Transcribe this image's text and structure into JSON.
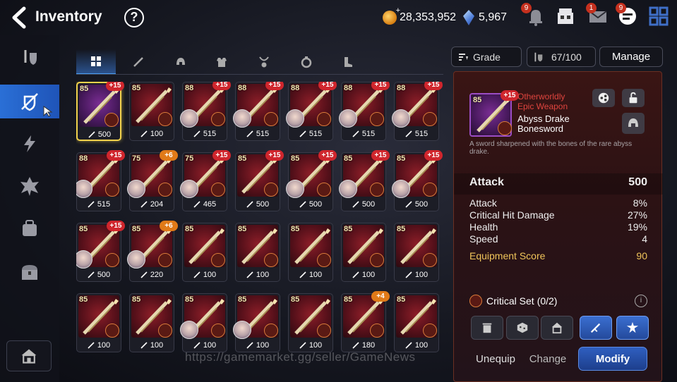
{
  "header": {
    "title": "Inventory",
    "help_label": "?",
    "gold": "28,353,952",
    "skystone": "5,967",
    "badges": {
      "alerts": "9",
      "mail": "1",
      "chat": "9"
    }
  },
  "sidebar": {
    "items": [
      "shield-icon",
      "gear-crossed-icon",
      "lightning-icon",
      "artifact-icon",
      "bag-icon",
      "chest-icon"
    ],
    "active_index": 1
  },
  "tabs": [
    "all",
    "weapon",
    "helmet",
    "armor",
    "necklace",
    "ring",
    "boots"
  ],
  "filter": {
    "sort_label": "Grade",
    "capacity": "67/100",
    "manage_label": "Manage"
  },
  "items": [
    {
      "lvl": "85",
      "enh": "+15",
      "score": "500",
      "hero": false,
      "purple": true,
      "selected": true
    },
    {
      "lvl": "85",
      "enh": "",
      "score": "100",
      "hero": false
    },
    {
      "lvl": "88",
      "enh": "+15",
      "score": "515",
      "hero": true
    },
    {
      "lvl": "88",
      "enh": "+15",
      "score": "515",
      "hero": true
    },
    {
      "lvl": "88",
      "enh": "+15",
      "score": "515",
      "hero": true
    },
    {
      "lvl": "88",
      "enh": "+15",
      "score": "515",
      "hero": true
    },
    {
      "lvl": "88",
      "enh": "+15",
      "score": "515",
      "hero": true
    },
    {
      "lvl": "88",
      "enh": "+15",
      "score": "515",
      "hero": true
    },
    {
      "lvl": "75",
      "enh": "+6",
      "score": "204",
      "hero": true,
      "orange": true
    },
    {
      "lvl": "75",
      "enh": "+15",
      "score": "465",
      "hero": true
    },
    {
      "lvl": "85",
      "enh": "+15",
      "score": "500",
      "hero": false
    },
    {
      "lvl": "85",
      "enh": "+15",
      "score": "500",
      "hero": true
    },
    {
      "lvl": "85",
      "enh": "+15",
      "score": "500",
      "hero": true
    },
    {
      "lvl": "85",
      "enh": "+15",
      "score": "500",
      "hero": true
    },
    {
      "lvl": "85",
      "enh": "+15",
      "score": "500",
      "hero": true
    },
    {
      "lvl": "85",
      "enh": "+6",
      "score": "220",
      "hero": true,
      "orange": true
    },
    {
      "lvl": "85",
      "enh": "",
      "score": "100",
      "hero": false
    },
    {
      "lvl": "85",
      "enh": "",
      "score": "100",
      "hero": false
    },
    {
      "lvl": "85",
      "enh": "",
      "score": "100",
      "hero": false
    },
    {
      "lvl": "85",
      "enh": "",
      "score": "100",
      "hero": false
    },
    {
      "lvl": "85",
      "enh": "",
      "score": "100",
      "hero": false
    },
    {
      "lvl": "85",
      "enh": "",
      "score": "100",
      "hero": false
    },
    {
      "lvl": "85",
      "enh": "",
      "score": "100",
      "hero": false
    },
    {
      "lvl": "85",
      "enh": "",
      "score": "100",
      "hero": true
    },
    {
      "lvl": "85",
      "enh": "",
      "score": "100",
      "hero": true
    },
    {
      "lvl": "85",
      "enh": "",
      "score": "100",
      "hero": false
    },
    {
      "lvl": "85",
      "enh": "+4",
      "score": "180",
      "hero": false,
      "orange": true
    },
    {
      "lvl": "85",
      "enh": "",
      "score": "100",
      "hero": false
    }
  ],
  "detail": {
    "grade": "Otherworldly\nEpic Weapon",
    "name": "Abyss Drake\nBonesword",
    "thumb_lvl": "85",
    "thumb_enh": "+15",
    "description": "A sword sharpened with the bones of the rare abyss drake.",
    "main_stat": {
      "label": "Attack",
      "value": "500"
    },
    "substats": [
      {
        "label": "Attack",
        "value": "8%"
      },
      {
        "label": "Critical Hit Damage",
        "value": "27%"
      },
      {
        "label": "Health",
        "value": "19%"
      },
      {
        "label": "Speed",
        "value": "4"
      }
    ],
    "equipment_score": {
      "label": "Equipment Score",
      "value": "90"
    },
    "set": {
      "label": "Critical Set",
      "count": "(0/2)"
    },
    "buttons": {
      "unequip": "Unequip",
      "change": "Change",
      "modify": "Modify"
    }
  },
  "watermark": "https://gamemarket.gg/seller/GameNews"
}
